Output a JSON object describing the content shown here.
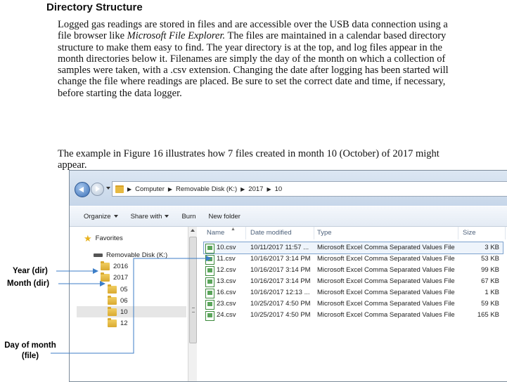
{
  "heading": "Directory Structure",
  "paragraphs": [
    {
      "before": "Logged gas readings are stored in files and are accessible over the USB data connection using a file browser like ",
      "emphasis": "Microsoft File Explorer.",
      "after": " The files are maintained in a calendar based directory structure to make them easy to find. The year directory is at the top, and log files appear in the month directories below it. Filenames are simply the day of the month on which a collection of samples were taken, with a .csv extension. Changing the date after logging has been started will change the file where readings are placed. Be sure to set the correct date and time, if necessary, before starting the data logger."
    },
    {
      "text": "The example in Figure 16 illustrates how 7 files created in month 10 (October) of 2017 might appear."
    }
  ],
  "explorer": {
    "breadcrumb": [
      "Computer",
      "Removable Disk (K:)",
      "2017",
      "10"
    ],
    "toolbar": [
      "Organize",
      "Share with",
      "Burn",
      "New folder"
    ],
    "nav": {
      "favorites": "Favorites",
      "drive": "Removable Disk (K:)",
      "years": [
        "2016",
        "2017"
      ],
      "months": [
        "05",
        "06",
        "10",
        "12"
      ]
    },
    "columns": [
      "Name",
      "Date modified",
      "Type",
      "Size"
    ],
    "files": [
      {
        "name": "10.csv",
        "date": "10/11/2017 11:57 ...",
        "type": "Microsoft Excel Comma Separated Values File",
        "size": "3 KB"
      },
      {
        "name": "11.csv",
        "date": "10/16/2017 3:14 PM",
        "type": "Microsoft Excel Comma Separated Values File",
        "size": "53 KB"
      },
      {
        "name": "12.csv",
        "date": "10/16/2017 3:14 PM",
        "type": "Microsoft Excel Comma Separated Values File",
        "size": "99 KB"
      },
      {
        "name": "13.csv",
        "date": "10/16/2017 3:14 PM",
        "type": "Microsoft Excel Comma Separated Values File",
        "size": "67 KB"
      },
      {
        "name": "16.csv",
        "date": "10/16/2017 12:13 ...",
        "type": "Microsoft Excel Comma Separated Values File",
        "size": "1 KB"
      },
      {
        "name": "23.csv",
        "date": "10/25/2017 4:50 PM",
        "type": "Microsoft Excel Comma Separated Values File",
        "size": "59 KB"
      },
      {
        "name": "24.csv",
        "date": "10/25/2017 4:50 PM",
        "type": "Microsoft Excel Comma Separated Values File",
        "size": "165 KB"
      }
    ]
  },
  "callouts": {
    "year": "Year (dir)",
    "month": "Month (dir)",
    "day_line1": "Day of month",
    "day_line2": "(file)"
  },
  "colors": {
    "callout_arrow": "#3c7ec7",
    "selected_outline": "#7da2ce"
  },
  "icons": [
    "back-arrow-icon",
    "forward-arrow-icon",
    "folder-icon",
    "star-icon",
    "drive-icon",
    "csv-file-icon"
  ]
}
